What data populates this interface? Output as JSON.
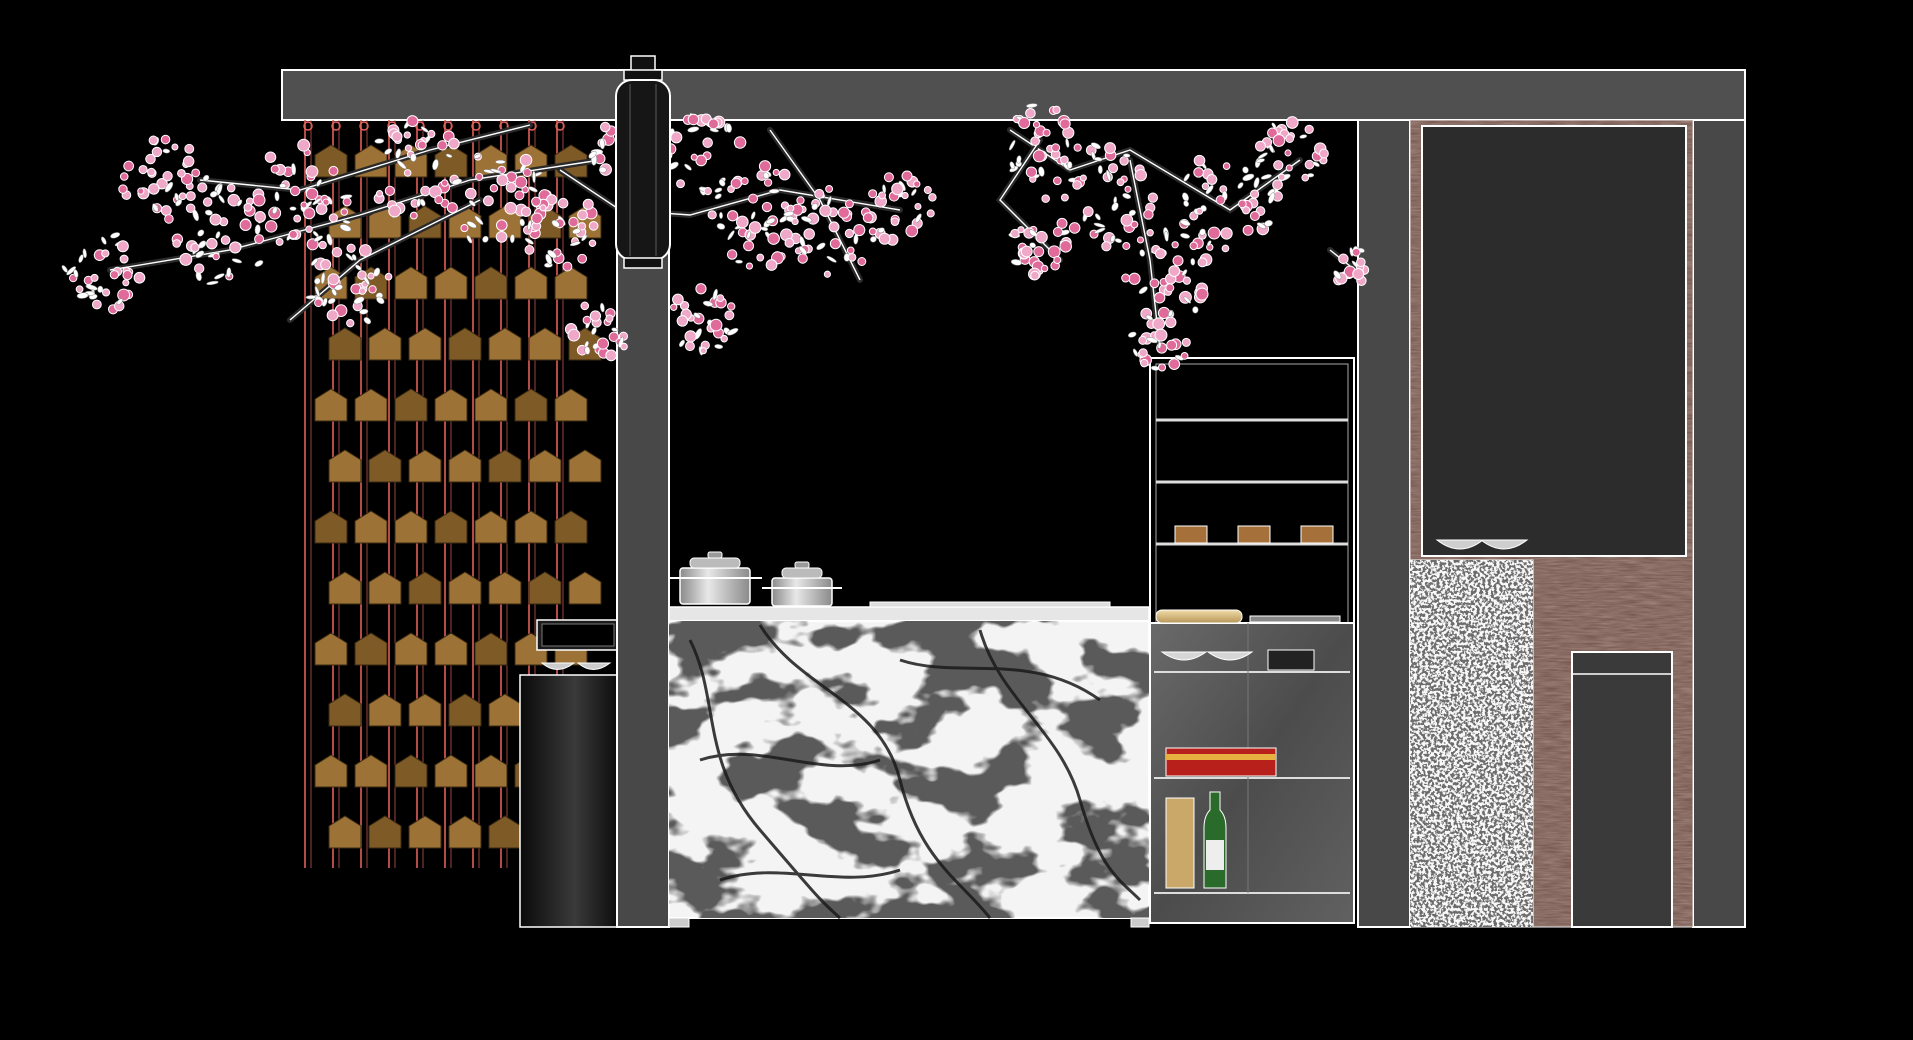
{
  "drawing": {
    "type": "interior-elevation",
    "background": "#000000",
    "colors": {
      "beam": "#505050",
      "column": "#484848",
      "outline": "#ffffff",
      "blossom_pink": "#f0a8c8",
      "blossom_deep": "#e06a9a",
      "ema_tablet": "#9c7236",
      "ema_cord": "#e0605a",
      "lantern": "#1a1a1a",
      "marble": "#f2f2f2",
      "marble_vein": "#202020",
      "steel_panel": "#5a5a5a",
      "screen": "#2c2c2c",
      "wood_panel": "#6e4f46",
      "door": "#3a3a3a",
      "bamboo": "#d9c08a"
    },
    "elements": [
      "ceiling-beam",
      "hanging-lantern",
      "cherry-blossom-branches",
      "ema-tablet-curtain",
      "black-cylinder-stand",
      "marble-counter",
      "cooking-pots",
      "display-shelving",
      "sake-bottles",
      "bowls",
      "bamboo-rolls",
      "kitchen-door",
      "wall-screen"
    ]
  }
}
